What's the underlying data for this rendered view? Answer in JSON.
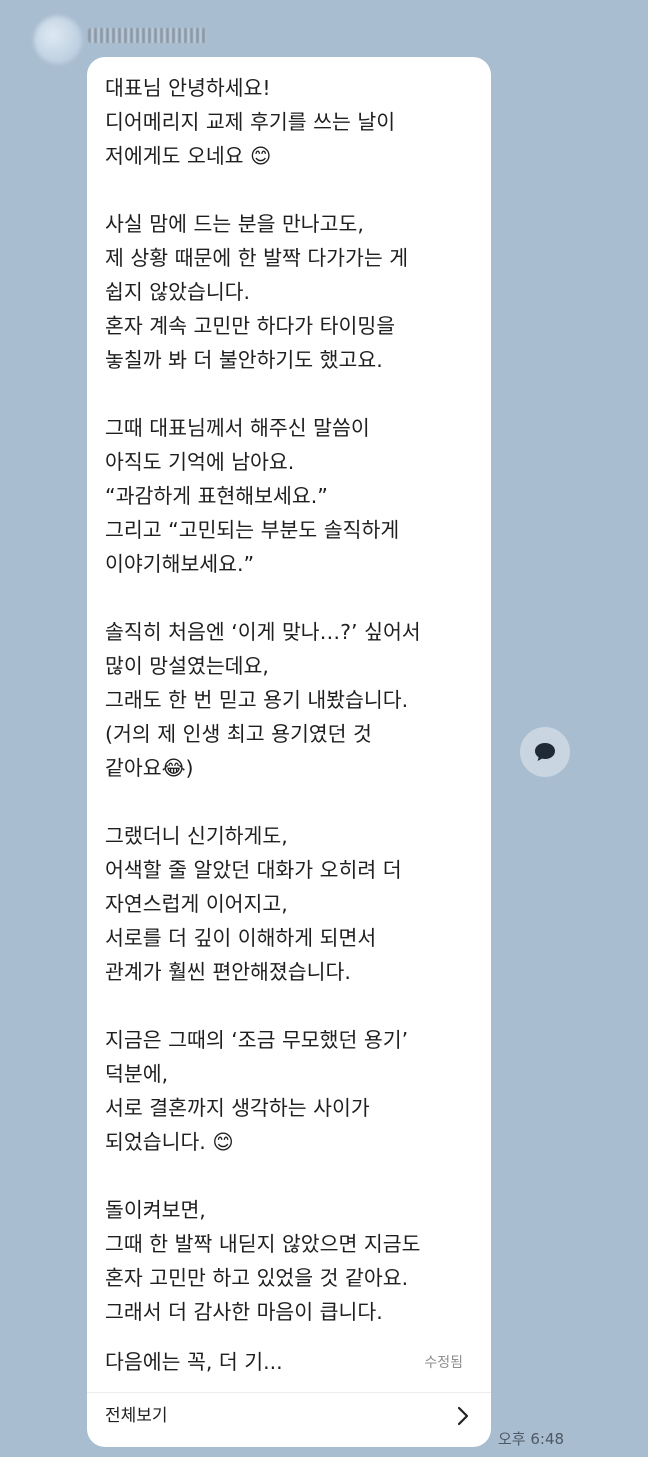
{
  "chat": {
    "message": "대표님 안녕하세요!\n디어메리지 교제 후기를 쓰는 날이\n저에게도 오네요 😊\n\n사실 맘에 드는 분을 만나고도,\n제 상황 때문에 한 발짝 다가가는 게\n쉽지 않았습니다.\n혼자 계속 고민만 하다가 타이밍을\n놓칠까 봐 더 불안하기도 했고요.\n\n그때 대표님께서 해주신 말씀이\n아직도 기억에 남아요.\n“과감하게 표현해보세요.”\n그리고 “고민되는 부분도 솔직하게\n이야기해보세요.”\n\n솔직히 처음엔 ‘이게 맞나…?’ 싶어서\n많이 망설였는데요,\n그래도 한 번 믿고 용기 내봤습니다.\n(거의 제 인생 최고 용기였던 것\n같아요😂)\n\n그랬더니 신기하게도,\n어색할 줄 알았던 대화가 오히려 더\n자연스럽게 이어지고,\n서로를 더 깊이 이해하게 되면서\n관계가 훨씬 편안해졌습니다.\n\n지금은 그때의 ‘조금 무모했던 용기’\n덕분에,\n서로 결혼까지 생각하는 사이가\n되었습니다. 😊\n\n돌이켜보면,\n그때 한 발짝 내딛지 않았으면 지금도\n혼자 고민만 하고 있었을 것 같아요.\n그래서 더 감사한 마음이 큽니다.",
    "truncated_line": "다음에는 꼭, 더 기...",
    "edited_label": "수정됨",
    "see_all_label": "전체보기",
    "time": "오후 6:48"
  },
  "icons": {
    "avatar": "avatar-blurred",
    "see_all": "chevron-right-icon",
    "side_action": "speech-bubble-icon"
  },
  "colors": {
    "background": "#a9bdd0",
    "bubble": "#ffffff"
  }
}
